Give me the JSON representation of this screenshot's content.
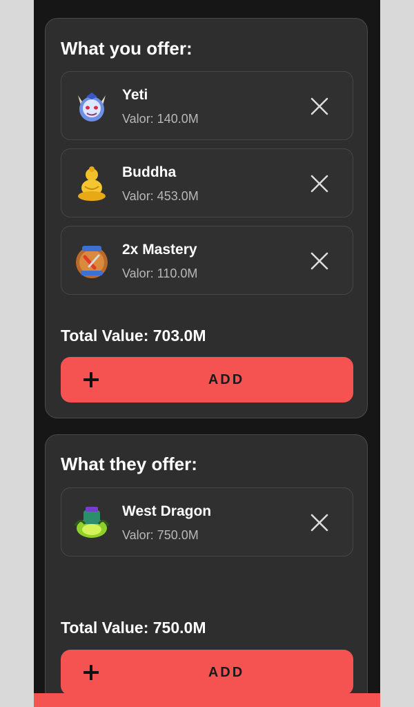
{
  "offer": {
    "title": "What you offer:",
    "items": [
      {
        "name": "Yeti",
        "value": "Valor: 140.0M",
        "icon": "yeti-icon"
      },
      {
        "name": "Buddha",
        "value": "Valor: 453.0M",
        "icon": "buddha-icon"
      },
      {
        "name": "2x Mastery",
        "value": "Valor: 110.0M",
        "icon": "mastery-icon"
      }
    ],
    "total": "Total Value: 703.0M",
    "add_label": "ADD"
  },
  "receive": {
    "title": "What they offer:",
    "items": [
      {
        "name": "West Dragon",
        "value": "Valor: 750.0M",
        "icon": "west-dragon-icon"
      }
    ],
    "total": "Total Value: 750.0M",
    "add_label": "ADD"
  },
  "colors": {
    "accent": "#f55252",
    "card": "#2e2e2e",
    "background": "#161616"
  }
}
